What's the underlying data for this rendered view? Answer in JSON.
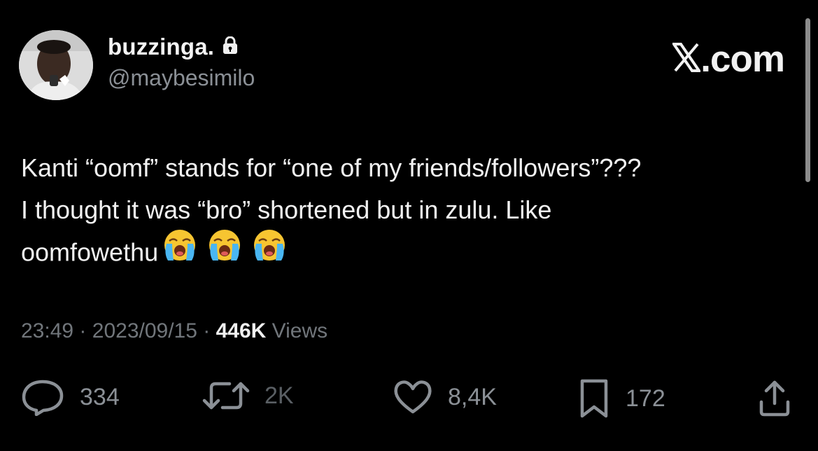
{
  "author": {
    "display_name": "buzzinga.",
    "handle": "@maybesimilo",
    "protected": true
  },
  "brand": {
    "label": ".com",
    "logo_glyph": "x-logo"
  },
  "tweet": {
    "lines": [
      "Kanti “oomf” stands for “one of my friends/followers”???",
      "I thought it was “bro” shortened but in zulu. Like",
      "oomfowethu"
    ],
    "emojis": [
      "loudly-crying-face",
      "loudly-crying-face",
      "loudly-crying-face"
    ]
  },
  "meta": {
    "time": "23:49",
    "date": "2023/09/15",
    "separator": "·",
    "views_count": "446K",
    "views_label": "Views"
  },
  "actions": {
    "replies": "334",
    "reposts": "2K",
    "likes": "8,4K",
    "bookmarks": "172"
  },
  "colors": {
    "background": "#000000",
    "text": "#e7e9ea",
    "muted": "#71767b"
  }
}
